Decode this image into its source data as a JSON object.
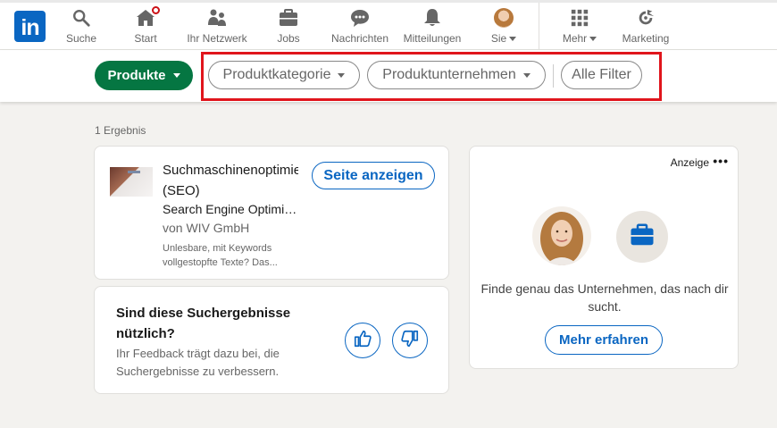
{
  "nav": {
    "logo_text": "in",
    "items": [
      {
        "label": "Suche",
        "icon": "search-icon"
      },
      {
        "label": "Start",
        "icon": "home-icon"
      },
      {
        "label": "Ihr Netzwerk",
        "icon": "network-icon"
      },
      {
        "label": "Jobs",
        "icon": "briefcase-icon"
      },
      {
        "label": "Nachrichten",
        "icon": "messaging-icon"
      },
      {
        "label": "Mitteilungen",
        "icon": "bell-icon"
      },
      {
        "label": "Sie",
        "icon": "avatar"
      },
      {
        "label": "Mehr",
        "icon": "grid-icon"
      },
      {
        "label": "Marketing",
        "icon": "marketing-icon"
      }
    ]
  },
  "filters": {
    "primary": "Produkte",
    "category": "Produktkategorie",
    "company": "Produktunternehmen",
    "all": "Alle Filter"
  },
  "results": {
    "count": "1 Ergebnis",
    "item": {
      "title_line1": "Suchmaschinenoptimierung",
      "title_line2": "(SEO)",
      "subtitle": "Search Engine Optimization",
      "company": "von WIV GmbH",
      "description": "Unlesbare, mit Keywords vollgestopfte Texte? Das...",
      "button": "Seite anzeigen"
    }
  },
  "feedback": {
    "question": "Sind diese Suchergebnisse nützlich?",
    "subtext": "Ihr Feedback trägt dazu bei, die Suchergebnisse zu verbessern."
  },
  "ad": {
    "label": "Anzeige",
    "more": "•••",
    "text": "Finde genau das Unternehmen, das nach dir sucht.",
    "button": "Mehr erfahren"
  },
  "colors": {
    "brand": "#0a66c2",
    "primary_green": "#057642",
    "highlight_red": "#e0151c",
    "notification": "#cc1016"
  }
}
